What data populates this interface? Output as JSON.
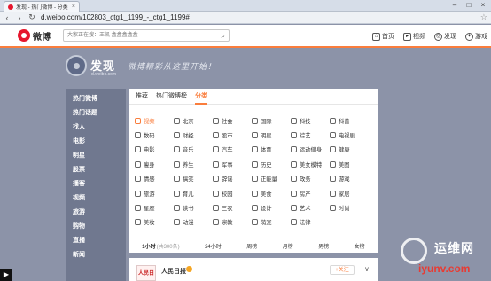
{
  "browser": {
    "tab_title": "发现 - 热门微博 - 分类",
    "tab_close": "×",
    "url": "d.weibo.com/102803_ctg1_1199_-_ctg1_1199#",
    "controls": [
      "–",
      "□",
      "×"
    ]
  },
  "topnav": {
    "logo_text": "微博",
    "search_placeholder": "大家正在搜：王凯 盒盒盒盒盒",
    "links": [
      {
        "label": "首页",
        "icon": "home-icon"
      },
      {
        "label": "视频",
        "icon": "video-icon"
      },
      {
        "label": "发现",
        "icon": "compass-icon"
      },
      {
        "label": "游戏",
        "icon": "gamepad-icon"
      }
    ]
  },
  "hero": {
    "title": "发现",
    "subtitle": "d.weibo.com",
    "slogan": "微博精彩从这里开始！"
  },
  "sidebar": {
    "items": [
      "热门微博",
      "热门话题",
      "找人",
      "电影",
      "明星",
      "股票",
      "播客",
      "视频",
      "旅游",
      "购物",
      "直播",
      "新闻"
    ]
  },
  "panel": {
    "tabs": [
      {
        "label": "推荐",
        "active": false
      },
      {
        "label": "热门微博榜",
        "active": false
      },
      {
        "label": "分类",
        "active": true
      }
    ],
    "categories": [
      {
        "label": "视频",
        "active": true
      },
      {
        "label": "北京"
      },
      {
        "label": "社会"
      },
      {
        "label": "国际"
      },
      {
        "label": "科技"
      },
      {
        "label": "科普"
      },
      {
        "label": "数码"
      },
      {
        "label": "财经"
      },
      {
        "label": "股市"
      },
      {
        "label": "明星"
      },
      {
        "label": "综艺"
      },
      {
        "label": "电视剧"
      },
      {
        "label": "电影"
      },
      {
        "label": "音乐"
      },
      {
        "label": "汽车"
      },
      {
        "label": "体育"
      },
      {
        "label": "运动健身"
      },
      {
        "label": "健康"
      },
      {
        "label": "瘦身"
      },
      {
        "label": "养生"
      },
      {
        "label": "军事"
      },
      {
        "label": "历史"
      },
      {
        "label": "美女模特"
      },
      {
        "label": "美图"
      },
      {
        "label": "情感"
      },
      {
        "label": "搞笑"
      },
      {
        "label": "辟谣"
      },
      {
        "label": "正能量"
      },
      {
        "label": "政务"
      },
      {
        "label": "游戏"
      },
      {
        "label": "旅游"
      },
      {
        "label": "育儿"
      },
      {
        "label": "校园"
      },
      {
        "label": "美食"
      },
      {
        "label": "房产"
      },
      {
        "label": "家居"
      },
      {
        "label": "星座"
      },
      {
        "label": "读书"
      },
      {
        "label": "三农"
      },
      {
        "label": "设计"
      },
      {
        "label": "艺术"
      },
      {
        "label": "时尚"
      },
      {
        "label": "美妆"
      },
      {
        "label": "动漫"
      },
      {
        "label": "宗教"
      },
      {
        "label": "萌宠"
      },
      {
        "label": "法律"
      }
    ]
  },
  "timefilter": [
    {
      "label": "1小时",
      "count": "(共300条)",
      "active": true
    },
    {
      "label": "24小时",
      "count": ""
    },
    {
      "label": "周榜",
      "count": ""
    },
    {
      "label": "月榜",
      "count": ""
    },
    {
      "label": "男榜",
      "count": ""
    },
    {
      "label": "女榜",
      "count": ""
    }
  ],
  "post": {
    "avatar_text": "人民日报",
    "name": "人民日报",
    "follow_label": "+关注",
    "chevron": "∨"
  },
  "watermark": {
    "cn": "运维网",
    "en": "iyunv.com"
  },
  "colors": {
    "accent": "#fa7d3c",
    "brand": "#e6162d"
  }
}
